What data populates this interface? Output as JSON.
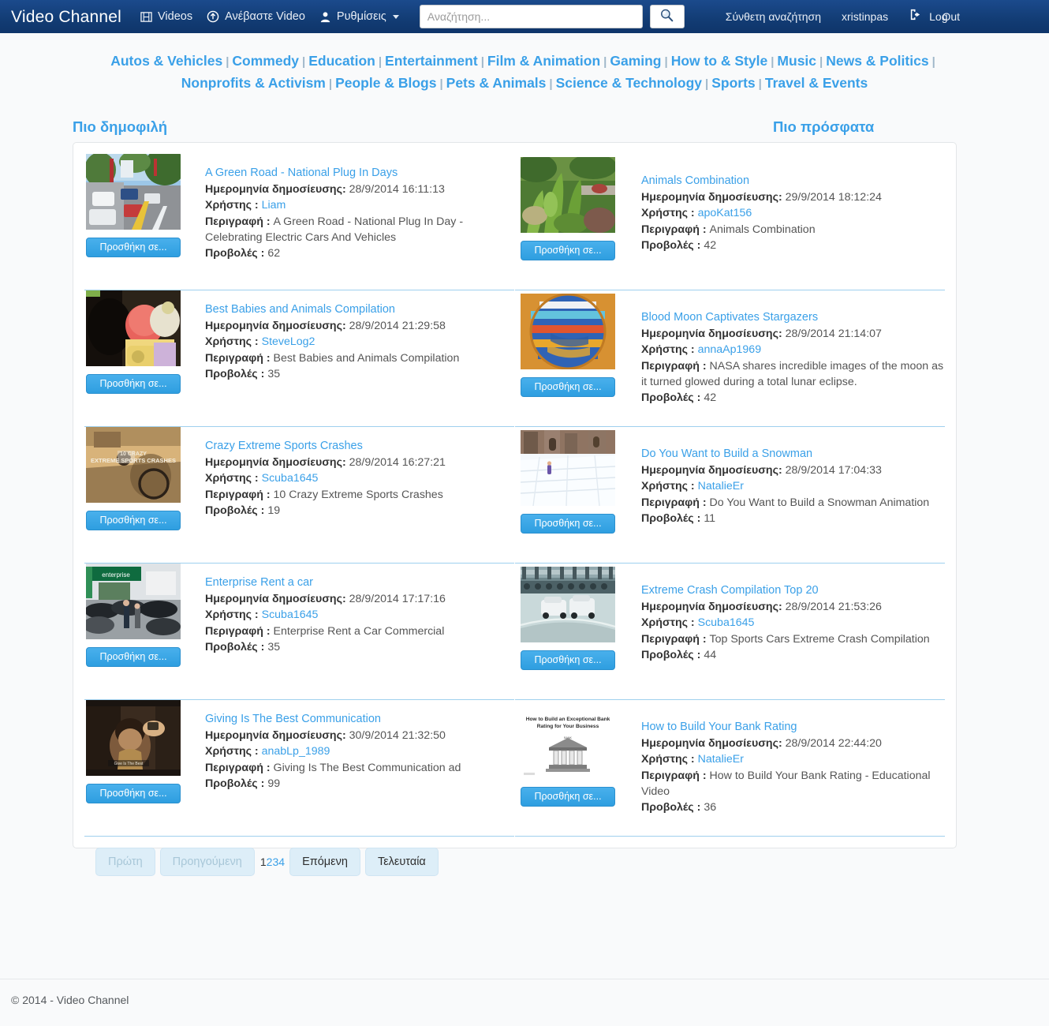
{
  "navbar": {
    "brand": "Video Channel",
    "videos_label": "Videos",
    "videos_icon": "film-icon",
    "upload_label": "Ανέβαστε  Video",
    "upload_icon": "upload-circle-icon",
    "settings_label": "Ρυθμίσεις",
    "settings_icon": "user-icon",
    "search_placeholder": "Αναζήτηση...",
    "search_value": "",
    "search_button_icon": "search-icon",
    "advanced_search": "Σύνθετη αναζήτηση",
    "username": "xristinpas",
    "logout_icon": "logout-icon",
    "log_label": "Log",
    "out_label": "Out"
  },
  "categories": [
    "Autos & Vehicles",
    "Commedy",
    "Education",
    "Entertainment",
    "Film & Animation",
    "Gaming",
    "How to & Style",
    "Music",
    "News & Politics",
    "Nonprofits & Activism",
    "People & Blogs",
    "Pets & Animals",
    "Science & Technology",
    "Sports",
    "Travel & Events"
  ],
  "sections": {
    "most_popular": "Πιο δημοφιλή",
    "most_recent": "Πιο πρόσφατα"
  },
  "labels": {
    "date": "Ημερομηνία δημοσίευσης:",
    "user": "Χρήστης :",
    "description": "Περιγραφή :",
    "views": "Προβολές :",
    "add_to": "Προσθήκη σε..."
  },
  "popular": [
    {
      "title": "A Green Road - National Plug In Days",
      "date": "28/9/2014 16:11:13",
      "user": "Liam",
      "description": "A Green Road - National Plug In Day - Celebrating Electric Cars And Vehicles",
      "views": "62",
      "thumb": "street-cars-parade"
    },
    {
      "title": "Best Babies and Animals Compilation",
      "date": "28/9/2014 21:29:58",
      "user": "SteveLog2",
      "description": "Best Babies and Animals Compilation",
      "views": "35",
      "thumb": "baby-with-cat"
    },
    {
      "title": "Crazy Extreme Sports Crashes",
      "date": "28/9/2014 16:27:21",
      "user": "Scuba1645",
      "description": "10 Crazy Extreme Sports Crashes",
      "views": "19",
      "thumb": "bike-crash-sepia"
    },
    {
      "title": "Enterprise Rent a car",
      "date": "28/9/2014 17:17:16",
      "user": "Scuba1645",
      "description": "Enterprise Rent a Car Commercial",
      "views": "35",
      "thumb": "car-rental-lot"
    },
    {
      "title": "Giving Is The Best Communication",
      "date": "30/9/2014 21:32:50",
      "user": "anabLp_1989",
      "description": "Giving Is The Best Communication ad",
      "views": "99",
      "thumb": "boy-dark-scene"
    }
  ],
  "recent": [
    {
      "title": "Animals Combination",
      "date": "29/9/2014 18:12:24",
      "user": "apoKat156",
      "description": "Animals Combination",
      "views": "42",
      "thumb": "green-plants"
    },
    {
      "title": "Blood Moon Captivates Stargazers",
      "date": "28/9/2014 21:14:07",
      "user": "annaAp1969",
      "description": "NASA shares incredible images of the moon as it turned glowed during a total lunar eclipse.",
      "views": "42",
      "thumb": "colorful-striped-sphere"
    },
    {
      "title": "Do You Want to Build a Snowman",
      "date": "28/9/2014 17:04:33",
      "user": "NatalieEr",
      "description": "Do You Want to Build a Snowman Animation",
      "views": "11",
      "thumb": "snow-castle"
    },
    {
      "title": "Extreme Crash Compilation Top 20",
      "date": "28/9/2014 21:53:26",
      "user": "Scuba1645",
      "description": "Top Sports Cars Extreme Crash Compilation",
      "views": "44",
      "thumb": "race-cars-track"
    },
    {
      "title": "How to Build Your Bank Rating",
      "date": "28/9/2014 22:44:20",
      "user": "NatalieEr",
      "description": "How to Build Your Bank Rating - Educational Video",
      "views": "36",
      "thumb": "bank-building-slide",
      "thumb_caption": "How to Build an Exceptional Bank Rating for Your Business"
    }
  ],
  "pager": {
    "first": "Πρώτη",
    "previous": "Προηγούμενη",
    "pages": [
      "1",
      "2",
      "3",
      "4"
    ],
    "current_page": "1",
    "next": "Επόμενη",
    "last": "Τελευταία"
  },
  "footer": {
    "copyright": "© 2014 - Video Channel"
  },
  "colors": {
    "navbar_bg": "#15417d",
    "link_blue": "#3aa0e8",
    "button_blue": "#2e9ee0",
    "divider": "#9fd0ee"
  }
}
